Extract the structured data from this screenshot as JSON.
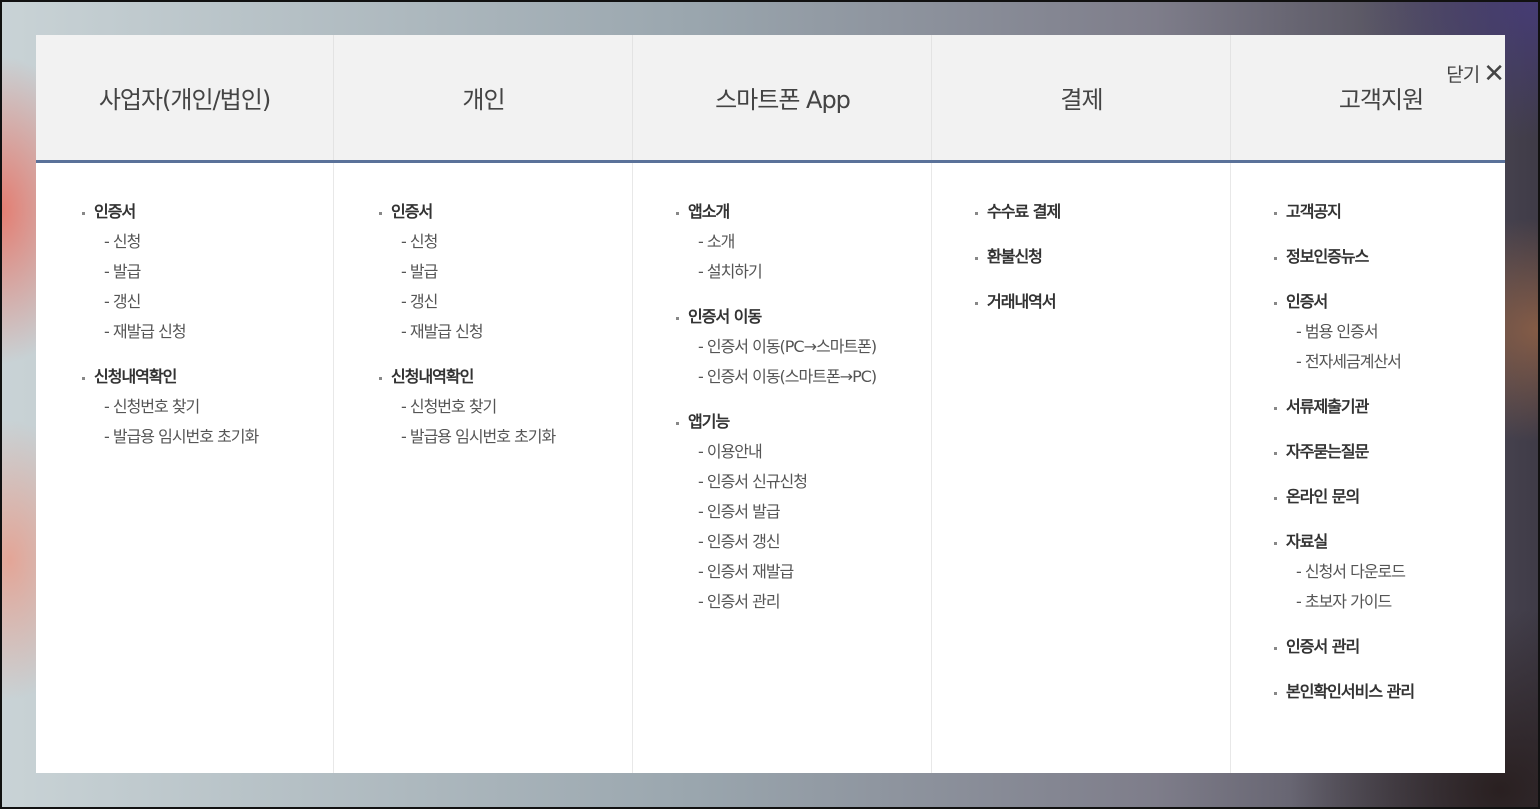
{
  "close": {
    "label": "닫기",
    "icon": "close-icon"
  },
  "columns": [
    {
      "title": "사업자(개인/법인)",
      "groups": [
        {
          "label": "인증서",
          "items": [
            "신청",
            "발급",
            "갱신",
            "재발급 신청"
          ]
        },
        {
          "label": "신청내역확인",
          "items": [
            "신청번호 찾기",
            "발급용 임시번호 초기화"
          ]
        }
      ]
    },
    {
      "title": "개인",
      "groups": [
        {
          "label": "인증서",
          "items": [
            "신청",
            "발급",
            "갱신",
            "재발급 신청"
          ]
        },
        {
          "label": "신청내역확인",
          "items": [
            "신청번호 찾기",
            "발급용 임시번호 초기화"
          ]
        }
      ]
    },
    {
      "title": "스마트폰 App",
      "groups": [
        {
          "label": "앱소개",
          "items": [
            "소개",
            "설치하기"
          ]
        },
        {
          "label": "인증서 이동",
          "items": [
            "인증서 이동(PC→스마트폰)",
            "인증서 이동(스마트폰→PC)"
          ]
        },
        {
          "label": "앱기능",
          "items": [
            "이용안내",
            "인증서 신규신청",
            "인증서 발급",
            "인증서 갱신",
            "인증서 재발급",
            "인증서 관리"
          ]
        }
      ]
    },
    {
      "title": "결제",
      "groups": [
        {
          "label": "수수료 결제",
          "items": []
        },
        {
          "label": "환불신청",
          "items": []
        },
        {
          "label": "거래내역서",
          "items": []
        }
      ]
    },
    {
      "title": "고객지원",
      "groups": [
        {
          "label": "고객공지",
          "items": []
        },
        {
          "label": "정보인증뉴스",
          "items": []
        },
        {
          "label": "인증서",
          "items": [
            "범용 인증서",
            "전자세금계산서"
          ]
        },
        {
          "label": "서류제출기관",
          "items": []
        },
        {
          "label": "자주묻는질문",
          "items": []
        },
        {
          "label": "온라인 문의",
          "items": []
        },
        {
          "label": "자료실",
          "items": [
            "신청서 다운로드",
            "초보자 가이드"
          ]
        },
        {
          "label": "인증서 관리",
          "items": []
        },
        {
          "label": "본인확인서비스 관리",
          "items": []
        }
      ]
    }
  ]
}
